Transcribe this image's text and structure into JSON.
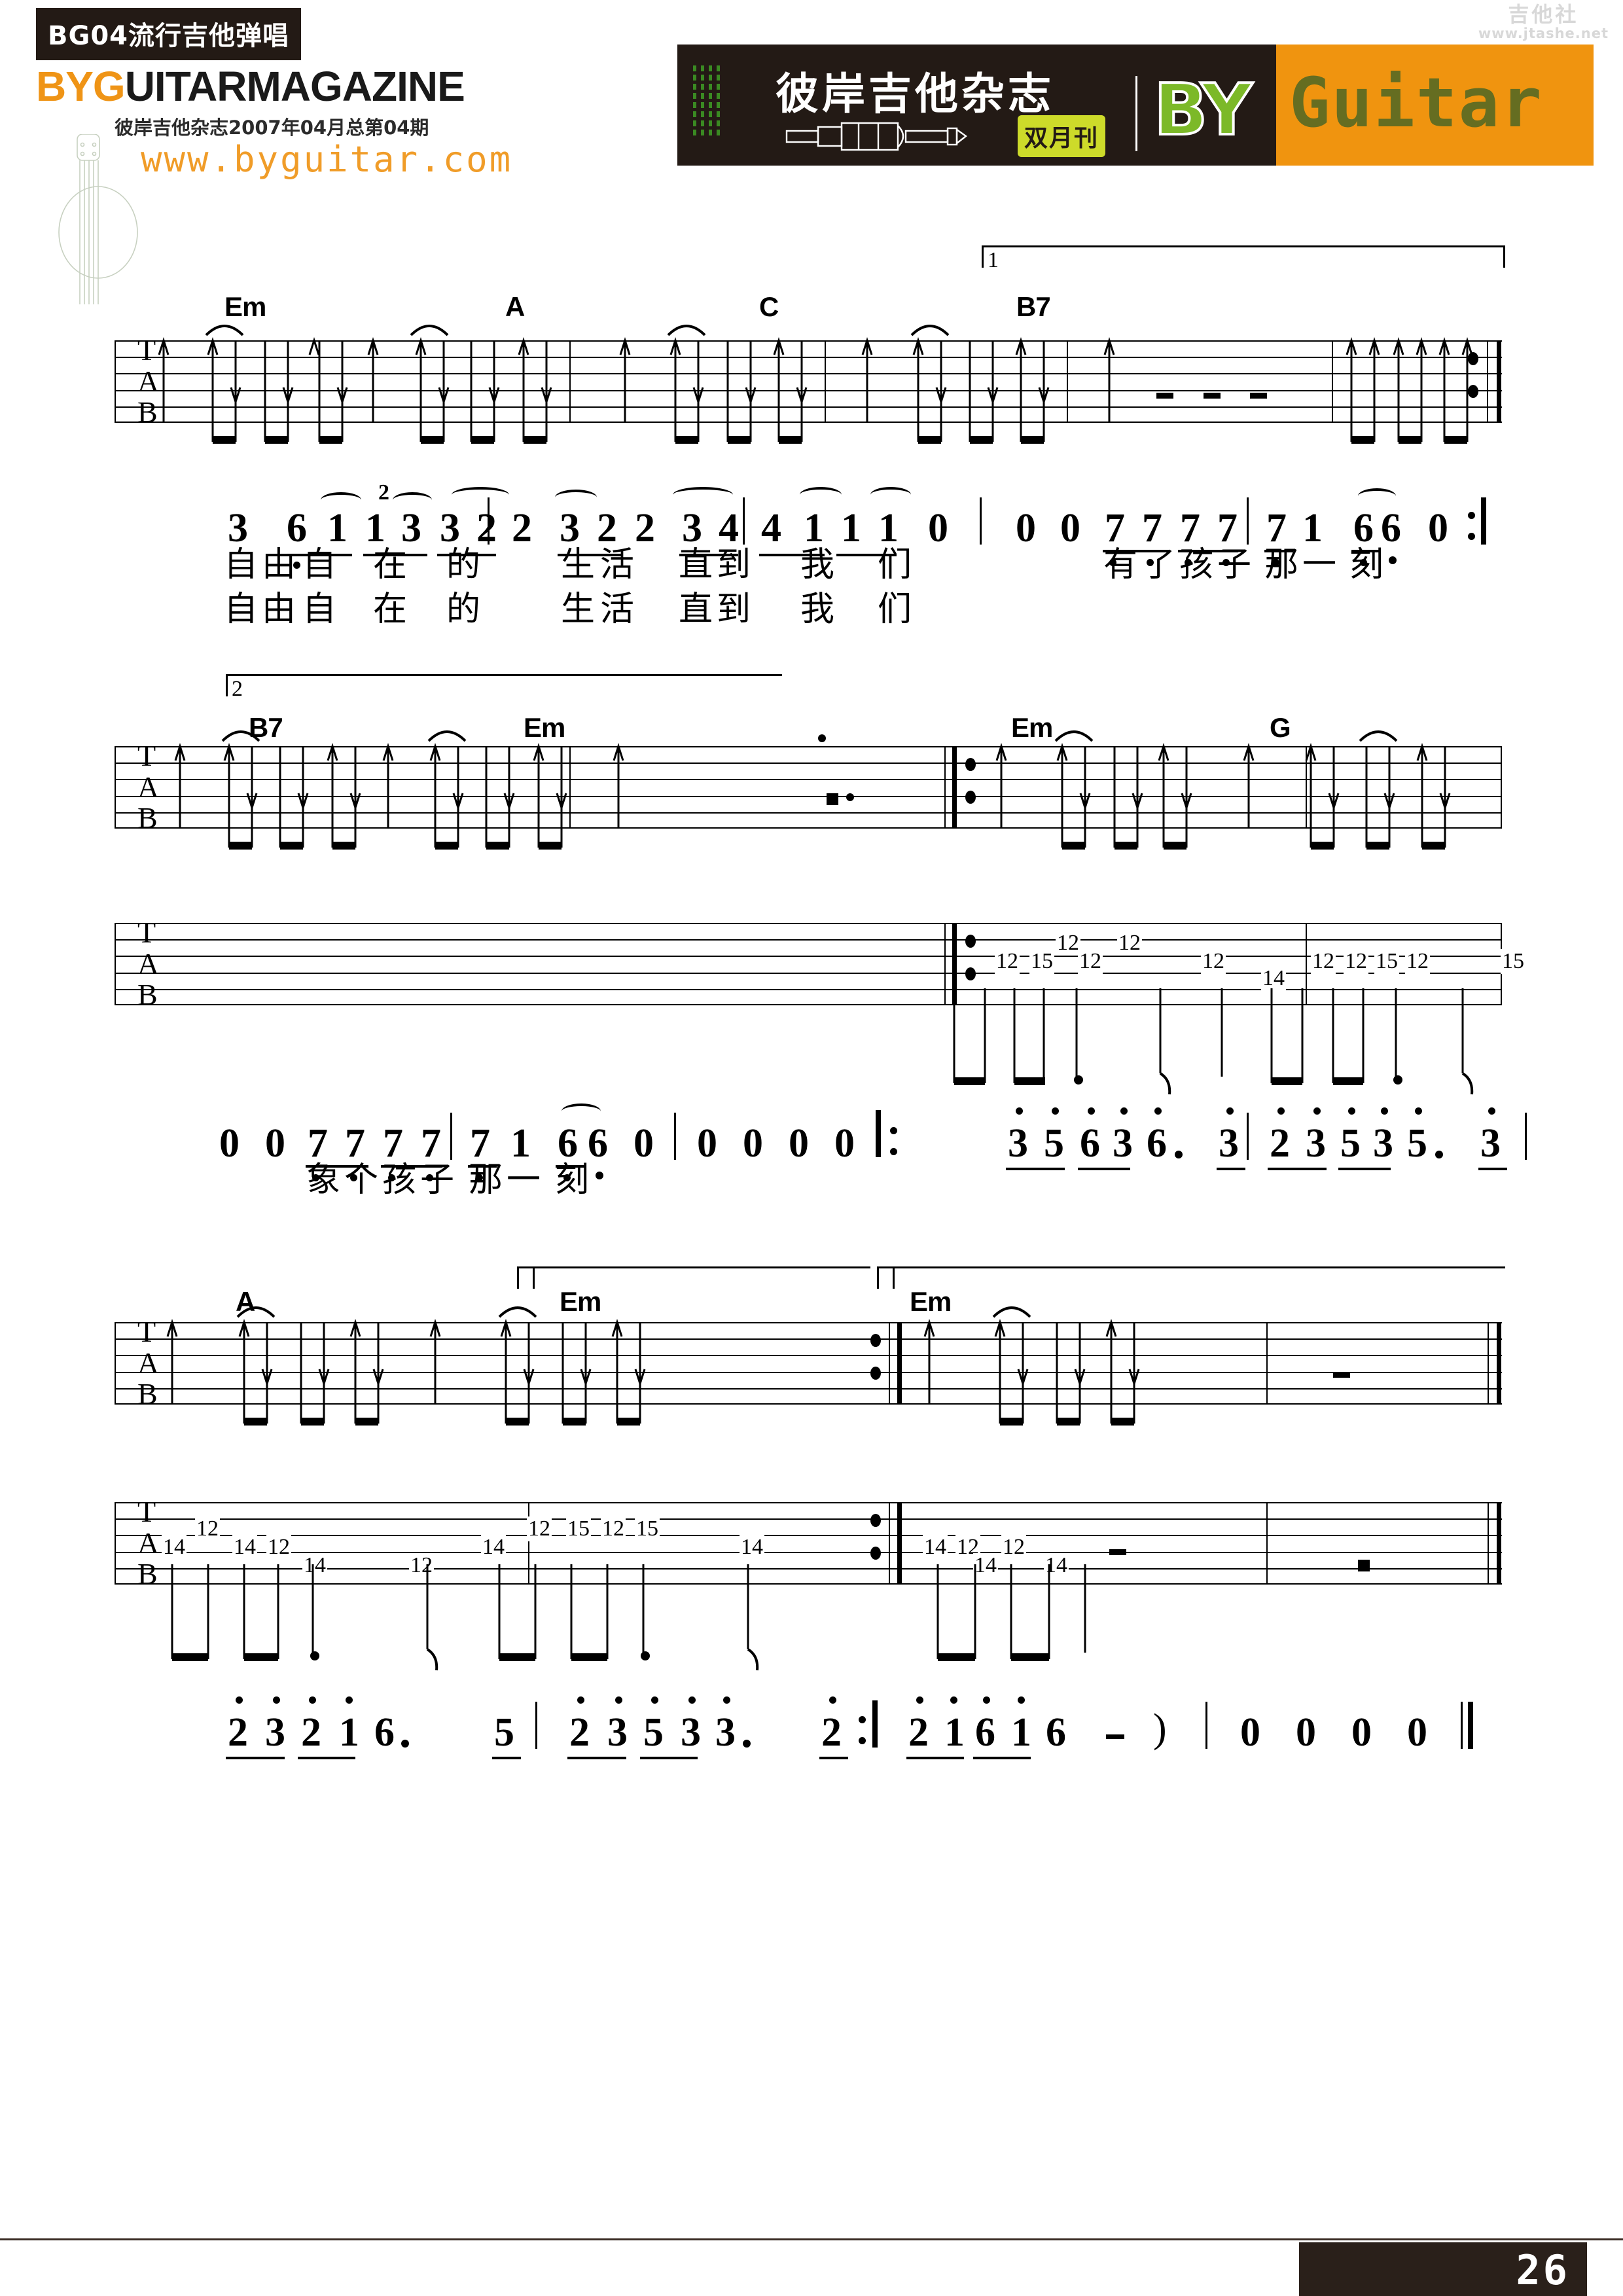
{
  "header": {
    "issue_badge": "BG04流行吉他弹唱",
    "brand_orange": "BYG",
    "brand_black": "UITARMAGAZINE",
    "issue_line": "彼岸吉他杂志2007年04月总第04期",
    "website": "www.byguitar.com",
    "masthead_cn": "彼岸吉他杂志",
    "bimonthly_badge": "双月刊",
    "logo_by": "BY",
    "logo_guitar": "Guitar",
    "watermark_cn": "吉他社",
    "watermark_url": "www.jtashe.net"
  },
  "footer": {
    "page_number": "26",
    "rule_color": "#3a2c24"
  },
  "colors": {
    "accent_orange": "#ef9416",
    "masthead_dark": "#231a15",
    "masthead_orange": "#f0940f",
    "logo_green": "#7cb928",
    "badge_yellow": "#cddb2a"
  },
  "score": {
    "tab_letters": [
      "T",
      "A",
      "B"
    ],
    "systems": [
      {
        "id": "system-1",
        "volta": "1",
        "chords": [
          "Em",
          "A",
          "C",
          "B7"
        ],
        "jianpu": {
          "measures": [
            {
              "notes": [
                "3",
                "6",
                "1",
                "1",
                "3",
                "3",
                "2"
              ]
            },
            {
              "notes": [
                "2",
                "3",
                "2",
                "2",
                "3",
                "4"
              ]
            },
            {
              "notes": [
                "4",
                "1",
                "1",
                "1",
                "0"
              ]
            },
            {
              "notes": [
                "0",
                "0",
                "7",
                "7",
                "7",
                "7"
              ]
            },
            {
              "notes": [
                "7",
                "1",
                "6",
                "6",
                "0"
              ]
            }
          ],
          "grace_note": "2"
        },
        "lyrics_line1": "自由自 在 的  生活  直到  我 们      有了孩子 那一 刻",
        "lyrics_line2": "自由自 在 的  生活  直到  我 们",
        "lyric1_cells": [
          "自",
          "由",
          "自",
          "在",
          "的",
          "生",
          "活",
          "直",
          "到",
          "我",
          "们",
          "有",
          "了",
          "孩",
          "子",
          "那",
          "一",
          "刻"
        ],
        "lyric2_cells": [
          "自",
          "由",
          "自",
          "在",
          "的",
          "生",
          "活",
          "直",
          "到",
          "我",
          "们"
        ]
      },
      {
        "id": "system-2",
        "volta": "2",
        "chords": [
          "B7",
          "Em",
          "Em",
          "G"
        ],
        "tab_frets_upper": [
          "12",
          "15",
          "12",
          "12",
          "12",
          "12",
          "12",
          "14",
          "12",
          "15",
          "12",
          "15",
          "12"
        ],
        "jianpu": {
          "measures": [
            {
              "notes": [
                "0",
                "0",
                "7",
                "7",
                "7",
                "7"
              ]
            },
            {
              "notes": [
                "7",
                "1",
                "6",
                "6",
                "0"
              ]
            },
            {
              "notes": [
                "0",
                "0",
                "0",
                "0"
              ]
            },
            {
              "notes": [
                "3",
                "5",
                "6",
                "3",
                "6",
                "3"
              ]
            },
            {
              "notes": [
                "2",
                "3",
                "5",
                "3",
                "5",
                "3"
              ]
            }
          ]
        },
        "lyrics_line1": "象个孩子 那一 刻",
        "lyric1_cells": [
          "象",
          "个",
          "孩",
          "子",
          "那",
          "一",
          "刻"
        ]
      },
      {
        "id": "system-3",
        "volta": "",
        "chords": [
          "A",
          "Em",
          "Em"
        ],
        "tab_frets_upper": [
          "12",
          "14",
          "14",
          "12",
          "14",
          "12",
          "14",
          "12",
          "15",
          "12",
          "15",
          "14",
          "14",
          "12",
          "12",
          "14",
          "14"
        ],
        "jianpu": {
          "measures": [
            {
              "notes": [
                "2",
                "3",
                "2",
                "1",
                "6",
                "5"
              ]
            },
            {
              "notes": [
                "2",
                "3",
                "5",
                "3",
                "3",
                "2"
              ]
            },
            {
              "notes": [
                "2",
                "1",
                "6",
                "1",
                "6",
                "-"
              ]
            },
            {
              "notes": [
                "0",
                "0",
                "0",
                "0"
              ]
            }
          ]
        }
      }
    ]
  }
}
